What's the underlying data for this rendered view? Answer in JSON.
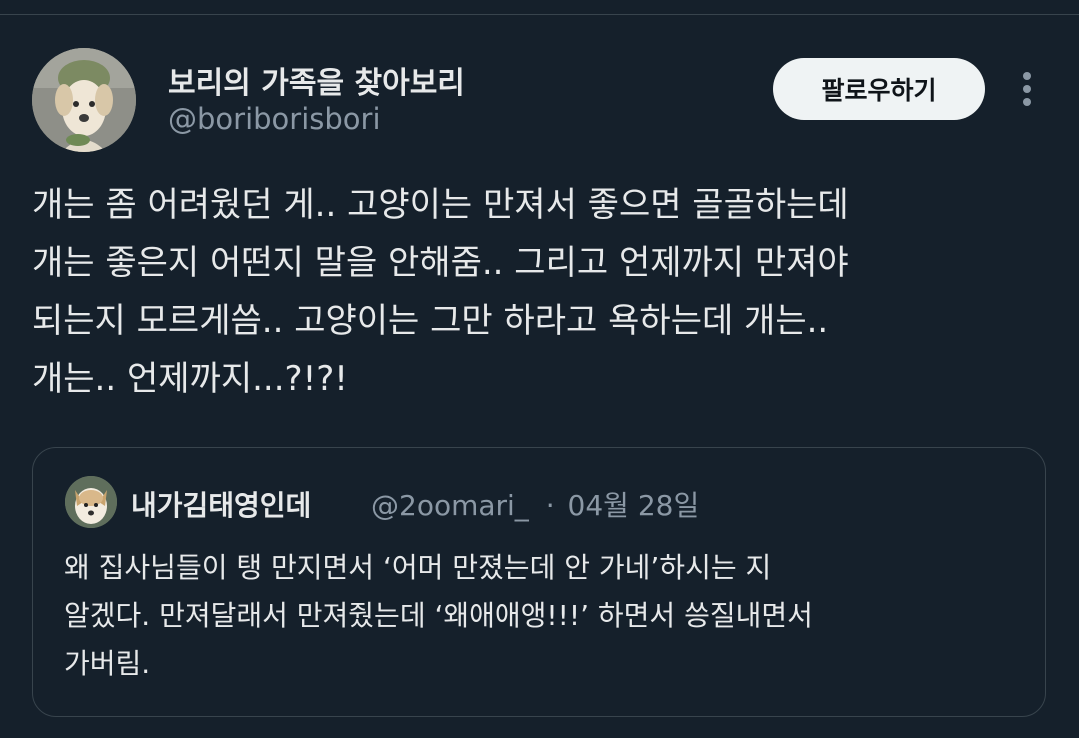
{
  "tweet": {
    "author": {
      "display_name": "보리의 가족을 찾아보리",
      "handle": "@boriborisbori",
      "avatar_icon": "dog-avatar"
    },
    "follow_label": "팔로우하기",
    "more_icon": "more-dots-icon",
    "text_lines": [
      "개는 좀 어려웠던 게.. 고양이는 만져서 좋으면 골골하는데",
      "개는 좋은지 어떤지 말을 안해줌.. 그리고 언제까지 만져야",
      "되는지 모르게씀.. 고양이는 그만 하라고 욕하는데 개는..",
      "개는.. 언제까지...?!?!"
    ]
  },
  "quoted_tweet": {
    "display_name": "내가김태영인데",
    "handle": "@2oomari_",
    "separator": "·",
    "date": "04월 28일",
    "avatar_icon": "dog-avatar",
    "text_lines": [
      "왜 집사님들이 탱 만지면서 ‘어머 만졌는데 안 가네’하시는 지",
      "알겠다. 만져달래서 만져줬는데 ‘왜애애앵!!!’ 하면서 씅질내면서",
      "가버림."
    ]
  },
  "colors": {
    "background": "#15202b",
    "text": "#e7e9ea",
    "secondary_text": "#8b98a5",
    "border": "#38444d",
    "button_bg": "#eff3f4"
  }
}
